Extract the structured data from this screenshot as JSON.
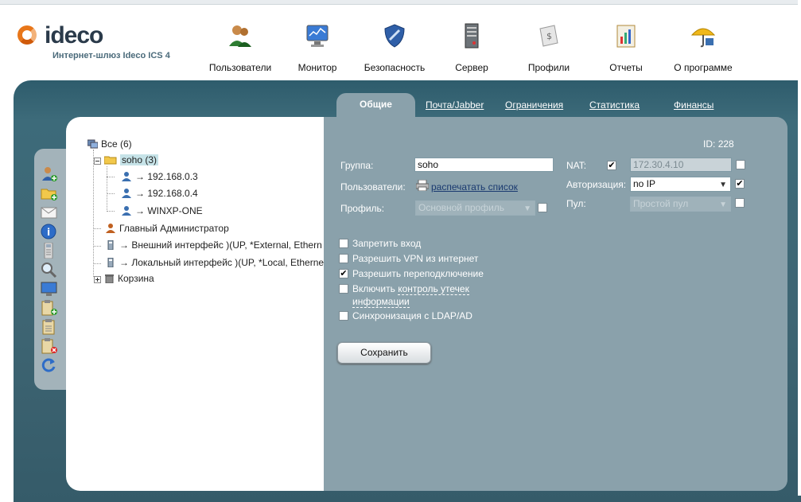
{
  "header": {
    "logo_text": "ideco",
    "logo_subtitle": "Интернет-шлюз Ideco ICS 4",
    "nav": [
      {
        "label": "Пользователи",
        "icon": "users-icon"
      },
      {
        "label": "Монитор",
        "icon": "monitor-icon"
      },
      {
        "label": "Безопасность",
        "icon": "shield-icon"
      },
      {
        "label": "Сервер",
        "icon": "server-icon"
      },
      {
        "label": "Профили",
        "icon": "profile-sheet-icon"
      },
      {
        "label": "Отчеты",
        "icon": "report-chart-icon"
      },
      {
        "label": "О программе",
        "icon": "umbrella-icon"
      }
    ]
  },
  "subtabs": [
    {
      "label": "Общие",
      "active": true
    },
    {
      "label": "Почта/Jabber",
      "active": false
    },
    {
      "label": "Ограничения",
      "active": false
    },
    {
      "label": "Статистика",
      "active": false
    },
    {
      "label": "Финансы",
      "active": false
    }
  ],
  "toolbar_icons": [
    "add-user-icon",
    "add-folder-icon",
    "mail-icon",
    "info-icon",
    "phone-icon",
    "search-icon",
    "monitor-icon",
    "clipboard-add-icon",
    "clipboard-icon",
    "clipboard-delete-icon",
    "refresh-icon"
  ],
  "tree": {
    "root": "Все (6)",
    "group": "soho (3)",
    "children": [
      "→ 192.168.0.3",
      "→ 192.168.0.4",
      "→ WINXP-ONE"
    ],
    "admin": "Главный Администратор",
    "iface_external": "→ Внешний интерфейс )(UP, *External, Ethern",
    "iface_local": "→ Локальный интерфейс )(UP, *Local, Etherne",
    "trash": "Корзина"
  },
  "form": {
    "id_label": "ID:",
    "id_value": "228",
    "group_label": "Группа:",
    "group_value": "soho",
    "users_label": "Пользователи:",
    "print_link": "распечатать список",
    "profile_label": "Профиль:",
    "profile_value": "Основной профиль",
    "profile_checked": false,
    "nat_label": "NAT:",
    "nat_checked": true,
    "nat_ip": "172.30.4.10",
    "nat_ip_checked": false,
    "auth_label": "Авторизация:",
    "auth_value": "no IP",
    "auth_checked": true,
    "pool_label": "Пул:",
    "pool_value": "Простой пул",
    "pool_checked": false,
    "options": [
      {
        "label": "Запретить вход",
        "checked": false
      },
      {
        "label": "Разрешить VPN из интернет",
        "checked": false
      },
      {
        "label": "Разрешить переподключение",
        "checked": true
      },
      {
        "label": "Включить контроль утечек информации",
        "checked": false
      },
      {
        "label": "Синхронизация с LDAP/AD",
        "checked": false
      }
    ],
    "option4_prefix": "Включить",
    "option4_link1": "контроль утечек",
    "option4_link2": "информации",
    "save_label": "Сохранить"
  },
  "colors": {
    "frame": "#3d6b7a",
    "form_panel": "#8aa1ab",
    "logo_orange": "#e8761a"
  }
}
